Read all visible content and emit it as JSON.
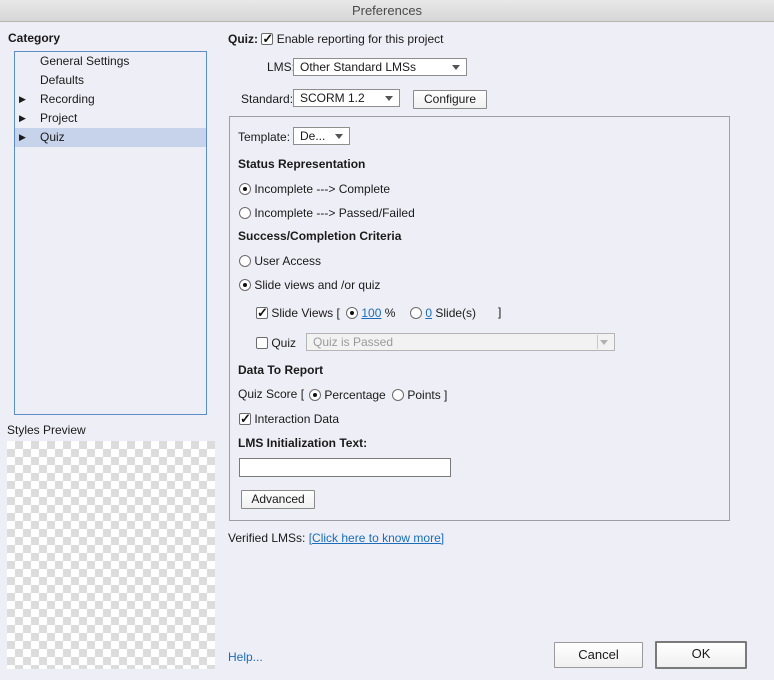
{
  "window": {
    "title": "Preferences"
  },
  "sidebar": {
    "category_label": "Category",
    "items": [
      {
        "label": "General Settings",
        "expandable": false,
        "selected": false
      },
      {
        "label": "Defaults",
        "expandable": false,
        "selected": false
      },
      {
        "label": "Recording",
        "expandable": true,
        "selected": false
      },
      {
        "label": "Project",
        "expandable": true,
        "selected": false
      },
      {
        "label": "Quiz",
        "expandable": true,
        "selected": true
      }
    ],
    "styles_preview_label": "Styles Preview"
  },
  "quiz": {
    "label": "Quiz:",
    "enable_reporting_label": "Enable reporting for this project",
    "enable_reporting_checked": true,
    "lms_label": "LMS:",
    "lms_value": "Other Standard LMSs",
    "standard_label": "Standard:",
    "standard_value": "SCORM 1.2",
    "configure_label": "Configure",
    "template_label": "Template:",
    "template_value": "De...",
    "status_representation": {
      "heading": "Status Representation",
      "option_complete": "Incomplete ---> Complete",
      "option_passed": "Incomplete ---> Passed/Failed",
      "selected": "complete"
    },
    "success_criteria": {
      "heading": "Success/Completion Criteria",
      "option_user_access": "User Access",
      "option_slide_views": "Slide views and /or quiz",
      "selected": "slide_views",
      "slide_views_label": "Slide Views [",
      "slide_views_checked": true,
      "percent_value": "100",
      "percent_unit": "%",
      "slides_value": "0",
      "slides_unit": "Slide(s)",
      "close_bracket": "]",
      "quiz_label": "Quiz",
      "quiz_checked": false,
      "quiz_dropdown_value": "Quiz is Passed"
    },
    "data_to_report": {
      "heading": "Data To Report",
      "quiz_score_label": "Quiz Score  [",
      "option_percentage": "Percentage",
      "option_points": "Points ]",
      "selected": "percentage",
      "interaction_data_label": "Interaction Data",
      "interaction_data_checked": true
    },
    "lms_init": {
      "heading": "LMS Initialization Text:",
      "value": ""
    },
    "advanced_label": "Advanced",
    "verified_lms_label": "Verified LMSs:",
    "verified_lms_link": "[Click here to know more]"
  },
  "footer": {
    "help_label": "Help...",
    "cancel_label": "Cancel",
    "ok_label": "OK"
  }
}
